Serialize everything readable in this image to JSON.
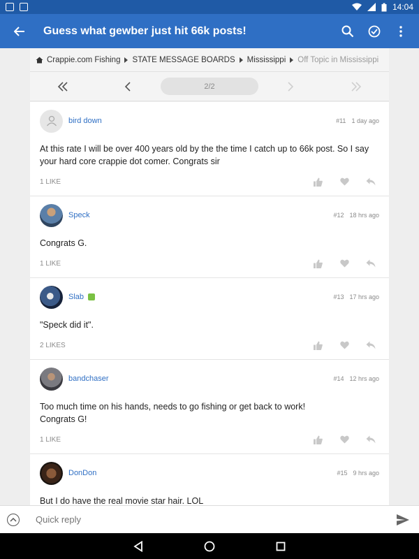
{
  "status_bar": {
    "time": "14:04"
  },
  "app_bar": {
    "title": "Guess what gewber just hit 66k posts!"
  },
  "breadcrumb": [
    {
      "label": "Crappie.com Fishing"
    },
    {
      "label": "STATE MESSAGE BOARDS"
    },
    {
      "label": "Mississippi"
    },
    {
      "label": "Off Topic in Mississippi"
    }
  ],
  "pager": {
    "page": "2/2"
  },
  "posts": [
    {
      "username": "bird down",
      "number": "#11",
      "time": "1 day ago",
      "lines": [
        "At this rate I will be over 400 years old by the the time I catch up to 66k post. So I say",
        "your hard core crappie dot comer. Congrats sir"
      ],
      "likes": "1 LIKE",
      "avatar_color": "#e0e0e0"
    },
    {
      "username": "Speck",
      "number": "#12",
      "time": "18 hrs ago",
      "lines": [
        "Congrats G."
      ],
      "likes": "1 LIKE",
      "avatar_color": "#4a6a8a"
    },
    {
      "username": "Slab",
      "number": "#13",
      "time": "17 hrs ago",
      "lines": [
        "\"Speck did it\"."
      ],
      "likes": "2 LIKES",
      "avatar_color": "#2a3a5a"
    },
    {
      "username": "bandchaser",
      "number": "#14",
      "time": "12 hrs ago",
      "lines": [
        "Too much time on his hands, needs to go fishing or get back to work!",
        "Congrats G!"
      ],
      "likes": "1 LIKE",
      "avatar_color": "#6a6a70"
    },
    {
      "username": "DonDon",
      "number": "#15",
      "time": "9 hrs ago",
      "lines": [
        "But I do have the real movie star hair. LOL"
      ],
      "likes": "",
      "avatar_color": "#5a3a2a"
    }
  ],
  "quick_reply": {
    "placeholder": "Quick reply"
  },
  "colors": {
    "primary": "#2f6fc4",
    "status_bar": "#1f5aa6",
    "link": "#2f6fc4"
  }
}
